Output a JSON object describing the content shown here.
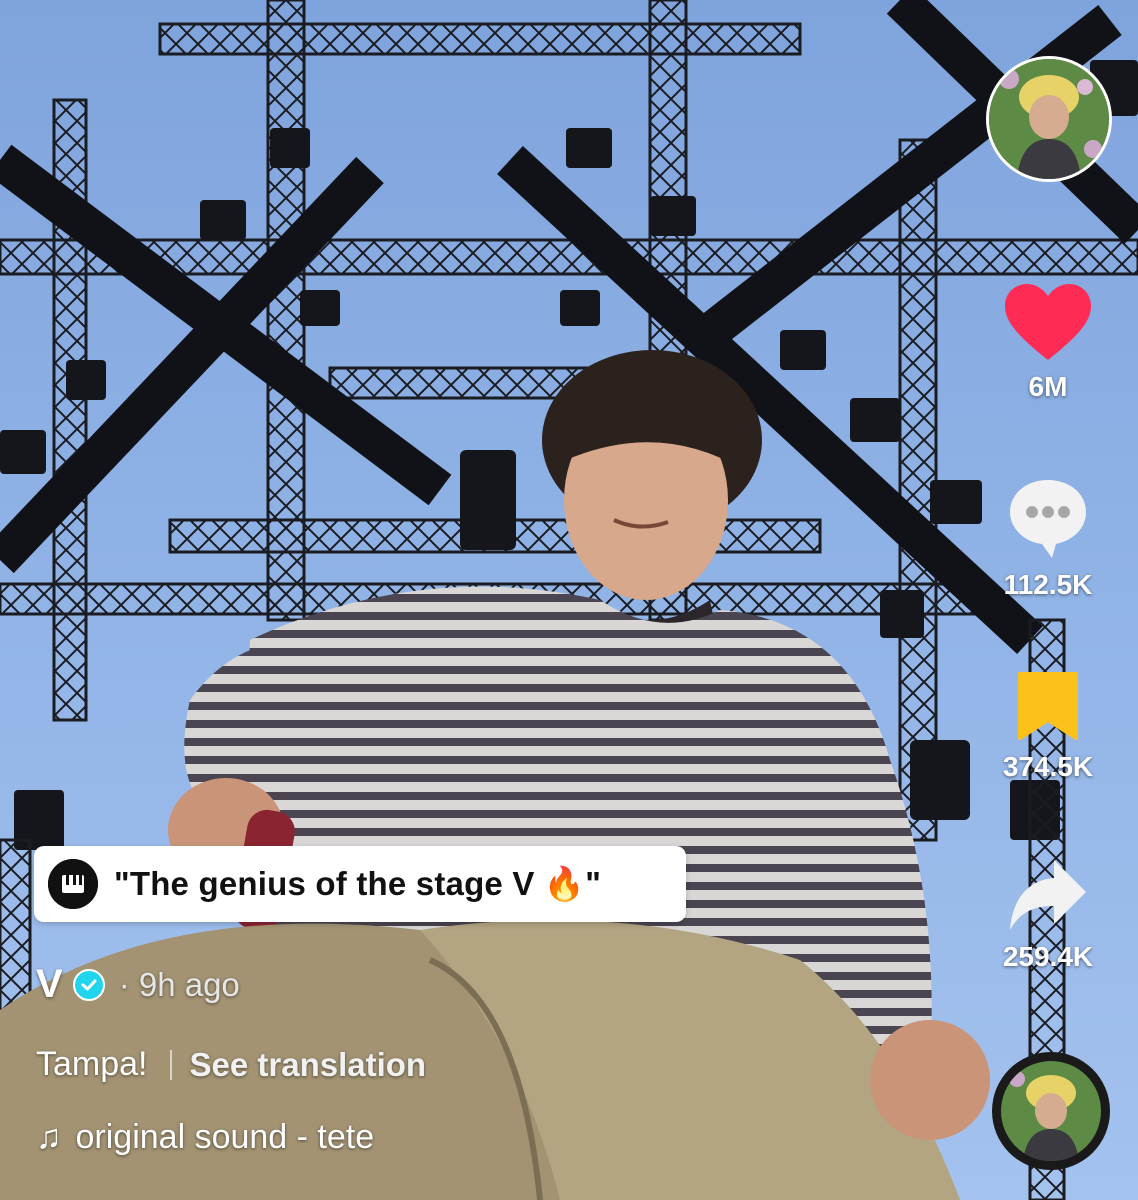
{
  "video": {
    "caption_sticker": "\"The genius of the stage V 🔥\"",
    "author_name": "V",
    "posted_time": "· 9h ago",
    "description": "Tampa!",
    "see_translation": "See translation",
    "sound": "original sound - tete"
  },
  "actions": {
    "likes": "6M",
    "comments": "112.5K",
    "saves": "374.5K",
    "shares": "259.4K"
  },
  "icons": {
    "like": "heart-icon",
    "comment": "comment-bubble-icon",
    "save": "bookmark-icon",
    "share": "share-arrow-icon",
    "sound": "music-note-icon"
  },
  "colors": {
    "like": "#fe2c55",
    "save": "#fcc21b",
    "verified": "#20d5ec"
  }
}
